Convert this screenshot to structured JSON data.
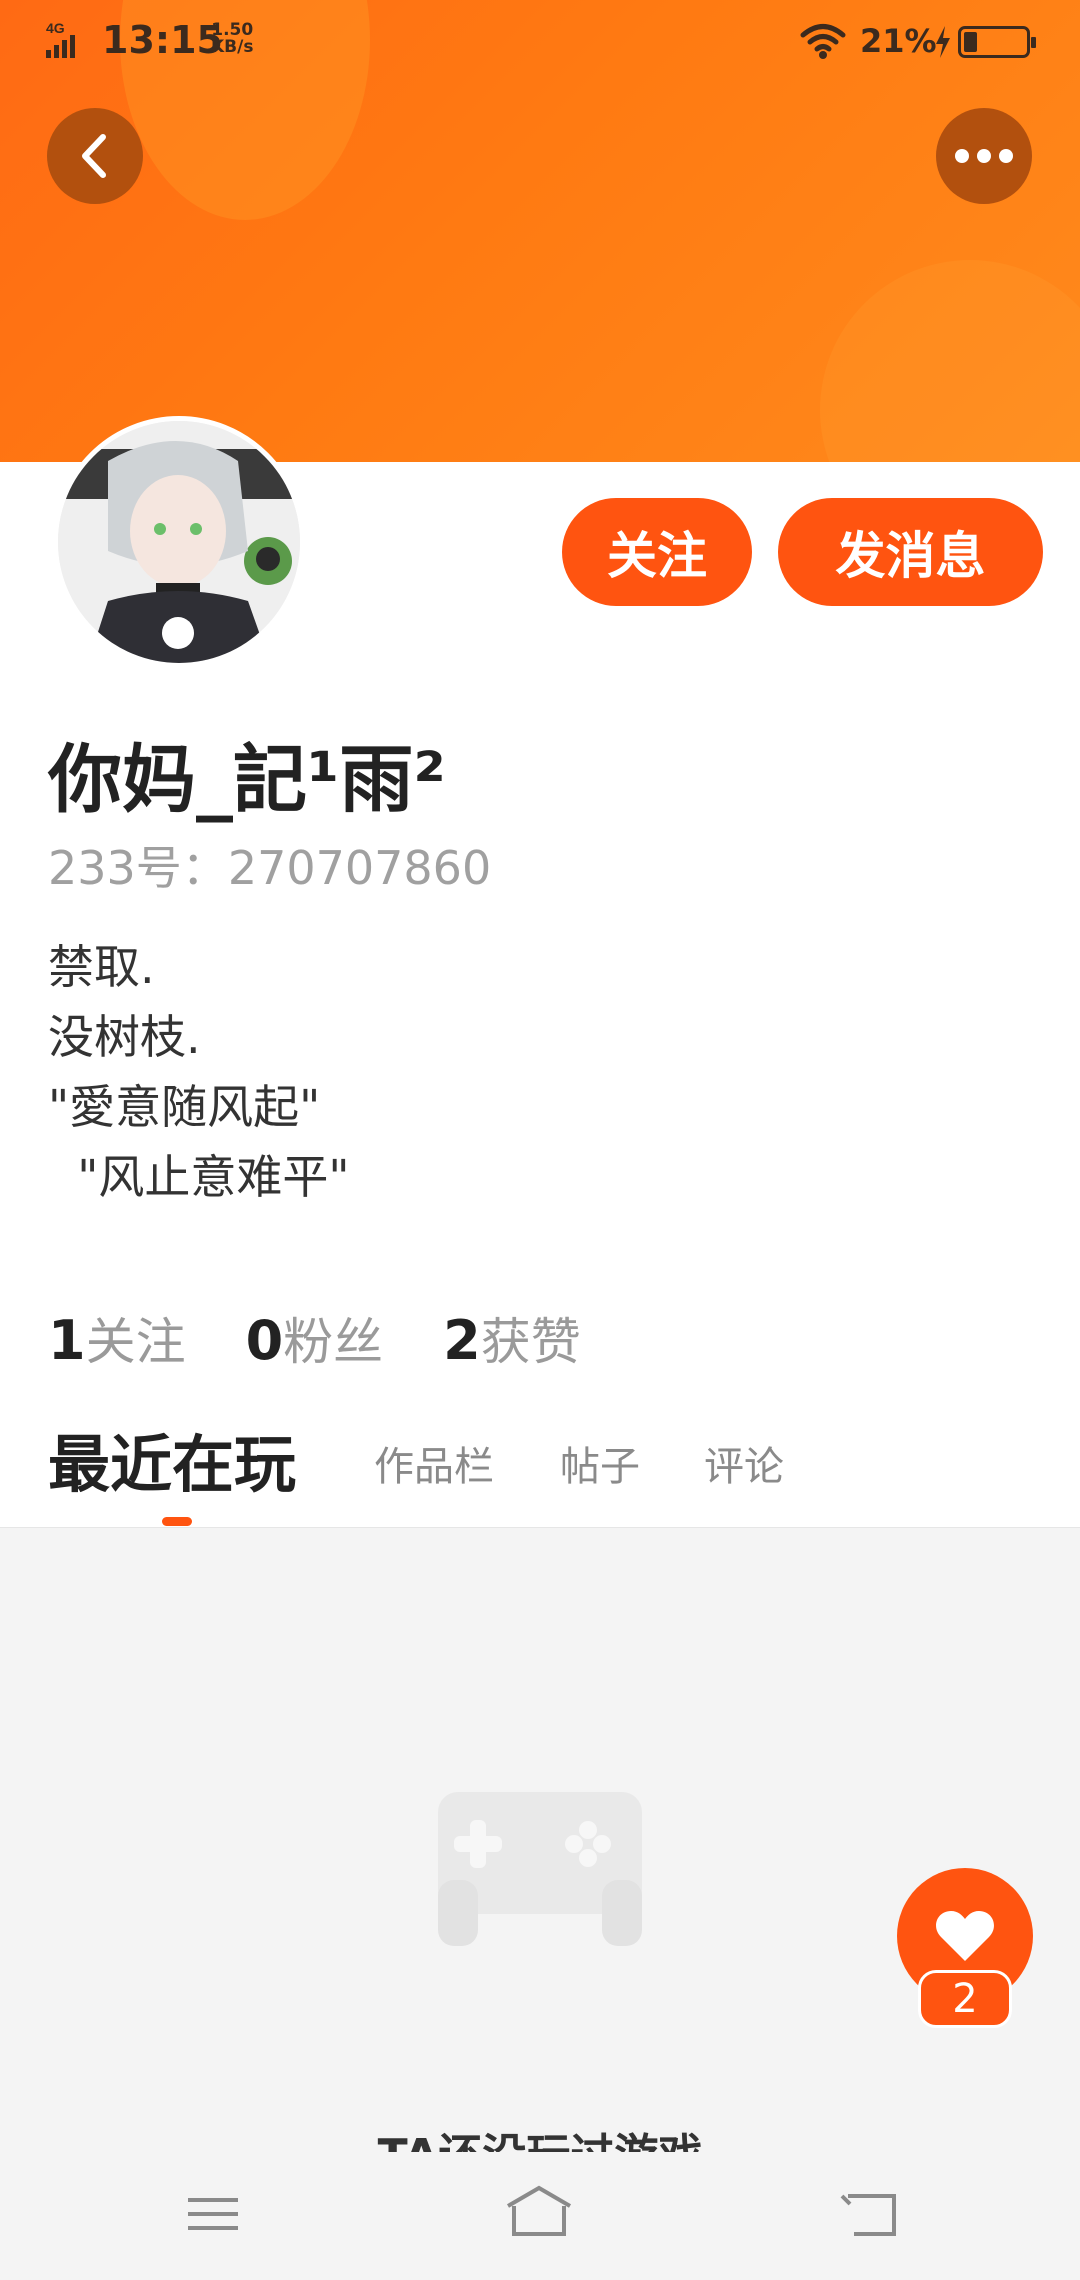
{
  "status_bar": {
    "network": "4G",
    "time": "13:15",
    "speed_value": "1.50",
    "speed_unit": "KB/s",
    "battery": "21%"
  },
  "header": {
    "back_icon": "chevron-left-icon",
    "more_icon": "ellipsis-icon"
  },
  "actions": {
    "follow_label": "关注",
    "message_label": "发消息"
  },
  "profile": {
    "username": "你妈_記¹雨²",
    "id_label": "233号：",
    "id_value": "270707860",
    "bio_lines": [
      "禁取.",
      "没树枝.",
      "\"愛意随风起\"",
      "  \"风止意难平\""
    ]
  },
  "stats": {
    "following_count": "1",
    "following_label": "关注",
    "followers_count": "0",
    "followers_label": "粉丝",
    "likes_count": "2",
    "likes_label": "获赞"
  },
  "tabs": [
    {
      "label": "最近在玩",
      "active": true
    },
    {
      "label": "作品栏",
      "active": false
    },
    {
      "label": "帖子",
      "active": false
    },
    {
      "label": "评论",
      "active": false
    }
  ],
  "empty_state": {
    "icon": "gamepad-icon",
    "text": "TA还没玩过游戏"
  },
  "like_fab": {
    "icon": "heart-icon",
    "count": "2"
  },
  "colors": {
    "accent": "#ff5410",
    "banner": "#ff7a12"
  }
}
